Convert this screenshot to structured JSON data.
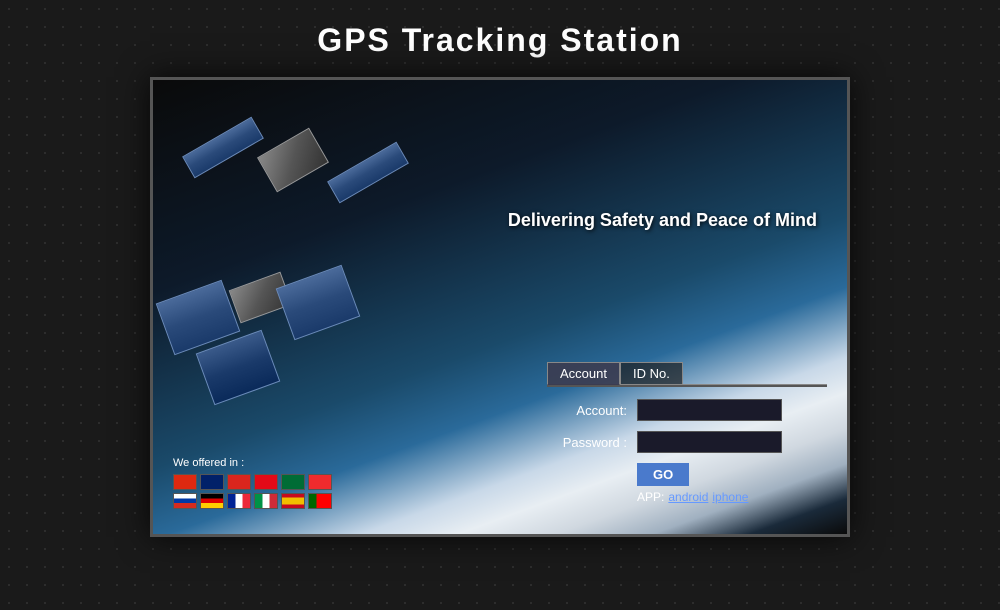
{
  "page": {
    "title": "GPS Tracking Station",
    "tagline": "Delivering Safety and Peace of Mind"
  },
  "tabs": [
    {
      "id": "account",
      "label": "Account",
      "active": true
    },
    {
      "id": "idno",
      "label": "ID No.",
      "active": false
    }
  ],
  "form": {
    "account_label": "Account:",
    "password_label": "Password :",
    "account_placeholder": "",
    "password_placeholder": ""
  },
  "buttons": {
    "go": "GO"
  },
  "app_links": {
    "prefix": "APP:",
    "android": "android",
    "iphone": "iphone"
  },
  "languages": {
    "label": "We offered in :",
    "flags": [
      "cn",
      "gb",
      "vn",
      "tr",
      "sa",
      "no",
      "ru",
      "de",
      "fr",
      "it",
      "es",
      "pt"
    ]
  }
}
